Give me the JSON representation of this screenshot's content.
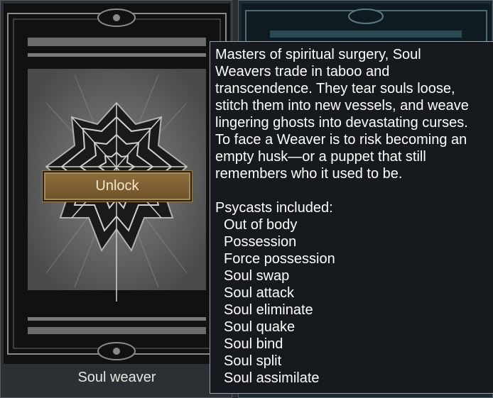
{
  "card": {
    "name": "Soul weaver",
    "unlock_label": "Unlock",
    "art_icon": "spider-web-emblem-icon"
  },
  "tooltip": {
    "description": "Masters of spiritual surgery, Soul\nWeavers trade in taboo and\ntranscendence. They tear souls loose,\nstitch them into new vessels, and weave\nlingering ghosts into devastating curses.\nTo face a Weaver is to risk becoming an\nempty husk—or a puppet that still\nremembers who it used to be.",
    "psycasts_title": "Psycasts included:",
    "psycasts": [
      "Out of body",
      "Possession",
      "Force possession",
      "Soul swap",
      "Soul attack",
      "Soul eliminate",
      "Soul quake",
      "Soul bind",
      "Soul split",
      "Soul assimilate"
    ]
  },
  "colors": {
    "unlock_button": "#7d6132",
    "tooltip_bg": "#161a1e",
    "card_bg": "#2c2f33"
  }
}
